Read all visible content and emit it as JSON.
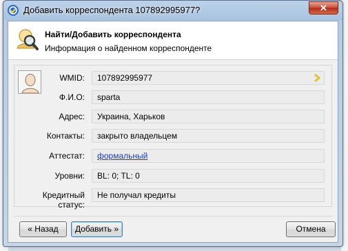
{
  "window": {
    "title": "Добавить корреспондента 107892995977?",
    "close_label": "✕"
  },
  "header": {
    "title": "Найти/Добавить корреспондента",
    "subtitle": "Информация о найденном корреспонденте"
  },
  "fields": [
    {
      "label": "WMID:",
      "value": "107892995977"
    },
    {
      "label": "Ф.И.О:",
      "value": "sparta"
    },
    {
      "label": "Адрес:",
      "value": "Украина, Харьков"
    },
    {
      "label": "Контакты:",
      "value": "закрыто владельцем"
    },
    {
      "label": "Аттестат:",
      "value": "формальный"
    },
    {
      "label": "Уровни:",
      "value": "BL: 0; TL: 0"
    },
    {
      "label": "Кредитный статус:",
      "value": "Не получал кредиты"
    }
  ],
  "buttons": {
    "back": "« Назад",
    "add": "Добавить »",
    "cancel": "Отмена"
  },
  "colors": {
    "link": "#1a3cb8",
    "close": "#c84b34",
    "arrow": "#e2b100"
  }
}
